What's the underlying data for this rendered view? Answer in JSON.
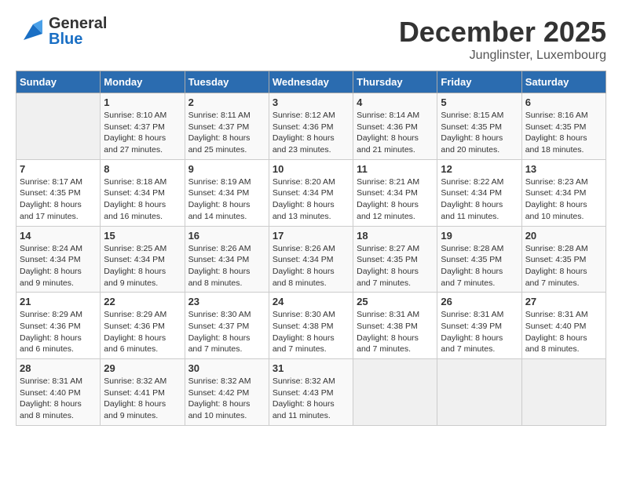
{
  "header": {
    "logo_general": "General",
    "logo_blue": "Blue",
    "month_title": "December 2025",
    "location": "Junglinster, Luxembourg"
  },
  "days_of_week": [
    "Sunday",
    "Monday",
    "Tuesday",
    "Wednesday",
    "Thursday",
    "Friday",
    "Saturday"
  ],
  "weeks": [
    [
      {
        "day": "",
        "info": ""
      },
      {
        "day": "1",
        "info": "Sunrise: 8:10 AM\nSunset: 4:37 PM\nDaylight: 8 hours\nand 27 minutes."
      },
      {
        "day": "2",
        "info": "Sunrise: 8:11 AM\nSunset: 4:37 PM\nDaylight: 8 hours\nand 25 minutes."
      },
      {
        "day": "3",
        "info": "Sunrise: 8:12 AM\nSunset: 4:36 PM\nDaylight: 8 hours\nand 23 minutes."
      },
      {
        "day": "4",
        "info": "Sunrise: 8:14 AM\nSunset: 4:36 PM\nDaylight: 8 hours\nand 21 minutes."
      },
      {
        "day": "5",
        "info": "Sunrise: 8:15 AM\nSunset: 4:35 PM\nDaylight: 8 hours\nand 20 minutes."
      },
      {
        "day": "6",
        "info": "Sunrise: 8:16 AM\nSunset: 4:35 PM\nDaylight: 8 hours\nand 18 minutes."
      }
    ],
    [
      {
        "day": "7",
        "info": "Sunrise: 8:17 AM\nSunset: 4:35 PM\nDaylight: 8 hours\nand 17 minutes."
      },
      {
        "day": "8",
        "info": "Sunrise: 8:18 AM\nSunset: 4:34 PM\nDaylight: 8 hours\nand 16 minutes."
      },
      {
        "day": "9",
        "info": "Sunrise: 8:19 AM\nSunset: 4:34 PM\nDaylight: 8 hours\nand 14 minutes."
      },
      {
        "day": "10",
        "info": "Sunrise: 8:20 AM\nSunset: 4:34 PM\nDaylight: 8 hours\nand 13 minutes."
      },
      {
        "day": "11",
        "info": "Sunrise: 8:21 AM\nSunset: 4:34 PM\nDaylight: 8 hours\nand 12 minutes."
      },
      {
        "day": "12",
        "info": "Sunrise: 8:22 AM\nSunset: 4:34 PM\nDaylight: 8 hours\nand 11 minutes."
      },
      {
        "day": "13",
        "info": "Sunrise: 8:23 AM\nSunset: 4:34 PM\nDaylight: 8 hours\nand 10 minutes."
      }
    ],
    [
      {
        "day": "14",
        "info": "Sunrise: 8:24 AM\nSunset: 4:34 PM\nDaylight: 8 hours\nand 9 minutes."
      },
      {
        "day": "15",
        "info": "Sunrise: 8:25 AM\nSunset: 4:34 PM\nDaylight: 8 hours\nand 9 minutes."
      },
      {
        "day": "16",
        "info": "Sunrise: 8:26 AM\nSunset: 4:34 PM\nDaylight: 8 hours\nand 8 minutes."
      },
      {
        "day": "17",
        "info": "Sunrise: 8:26 AM\nSunset: 4:34 PM\nDaylight: 8 hours\nand 8 minutes."
      },
      {
        "day": "18",
        "info": "Sunrise: 8:27 AM\nSunset: 4:35 PM\nDaylight: 8 hours\nand 7 minutes."
      },
      {
        "day": "19",
        "info": "Sunrise: 8:28 AM\nSunset: 4:35 PM\nDaylight: 8 hours\nand 7 minutes."
      },
      {
        "day": "20",
        "info": "Sunrise: 8:28 AM\nSunset: 4:35 PM\nDaylight: 8 hours\nand 7 minutes."
      }
    ],
    [
      {
        "day": "21",
        "info": "Sunrise: 8:29 AM\nSunset: 4:36 PM\nDaylight: 8 hours\nand 6 minutes."
      },
      {
        "day": "22",
        "info": "Sunrise: 8:29 AM\nSunset: 4:36 PM\nDaylight: 8 hours\nand 6 minutes."
      },
      {
        "day": "23",
        "info": "Sunrise: 8:30 AM\nSunset: 4:37 PM\nDaylight: 8 hours\nand 7 minutes."
      },
      {
        "day": "24",
        "info": "Sunrise: 8:30 AM\nSunset: 4:38 PM\nDaylight: 8 hours\nand 7 minutes."
      },
      {
        "day": "25",
        "info": "Sunrise: 8:31 AM\nSunset: 4:38 PM\nDaylight: 8 hours\nand 7 minutes."
      },
      {
        "day": "26",
        "info": "Sunrise: 8:31 AM\nSunset: 4:39 PM\nDaylight: 8 hours\nand 7 minutes."
      },
      {
        "day": "27",
        "info": "Sunrise: 8:31 AM\nSunset: 4:40 PM\nDaylight: 8 hours\nand 8 minutes."
      }
    ],
    [
      {
        "day": "28",
        "info": "Sunrise: 8:31 AM\nSunset: 4:40 PM\nDaylight: 8 hours\nand 8 minutes."
      },
      {
        "day": "29",
        "info": "Sunrise: 8:32 AM\nSunset: 4:41 PM\nDaylight: 8 hours\nand 9 minutes."
      },
      {
        "day": "30",
        "info": "Sunrise: 8:32 AM\nSunset: 4:42 PM\nDaylight: 8 hours\nand 10 minutes."
      },
      {
        "day": "31",
        "info": "Sunrise: 8:32 AM\nSunset: 4:43 PM\nDaylight: 8 hours\nand 11 minutes."
      },
      {
        "day": "",
        "info": ""
      },
      {
        "day": "",
        "info": ""
      },
      {
        "day": "",
        "info": ""
      }
    ]
  ]
}
